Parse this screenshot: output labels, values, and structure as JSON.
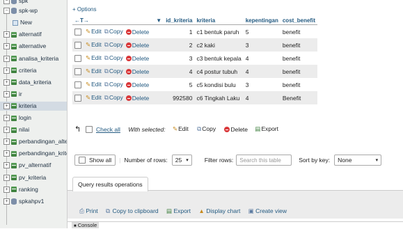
{
  "nav": {
    "top_partial": "spk",
    "items": [
      {
        "label": "spk-wp",
        "kind": "db",
        "expander": "−"
      },
      {
        "label": "New",
        "kind": "new",
        "expander": ""
      },
      {
        "label": "alternatif",
        "kind": "table",
        "expander": "+"
      },
      {
        "label": "alternative",
        "kind": "table",
        "expander": "+"
      },
      {
        "label": "analisa_kriteria",
        "kind": "table",
        "expander": "+"
      },
      {
        "label": "criteria",
        "kind": "table",
        "expander": "+"
      },
      {
        "label": "data_kriteria",
        "kind": "table",
        "expander": "+"
      },
      {
        "label": "ir",
        "kind": "table",
        "expander": "+"
      },
      {
        "label": "kriteria",
        "kind": "table",
        "expander": "+",
        "selected": true
      },
      {
        "label": "login",
        "kind": "table",
        "expander": "+"
      },
      {
        "label": "nilai",
        "kind": "table",
        "expander": "+"
      },
      {
        "label": "perbandingan_alternatif",
        "kind": "table",
        "expander": "+"
      },
      {
        "label": "perbandingan_kriteria",
        "kind": "table",
        "expander": "+"
      },
      {
        "label": "pv_alternatif",
        "kind": "table",
        "expander": "+"
      },
      {
        "label": "pv_kriteria",
        "kind": "table",
        "expander": "+"
      },
      {
        "label": "ranking",
        "kind": "table",
        "expander": "+"
      },
      {
        "label": "spkahpv1",
        "kind": "db",
        "expander": "+"
      }
    ]
  },
  "options_link": "+ Options",
  "table": {
    "header_arrows": "←T→",
    "sort_indicator": "▼",
    "columns": [
      "id_kriteria",
      "kriteria",
      "kepentingan",
      "cost_benefit"
    ],
    "actions": {
      "edit": "Edit",
      "copy": "Copy",
      "delete": "Delete"
    },
    "rows": [
      {
        "id": "1",
        "kriteria": "c1 bentuk paruh",
        "kepentingan": "5",
        "cost_benefit": "benefit"
      },
      {
        "id": "2",
        "kriteria": "c2 kaki",
        "kepentingan": "3",
        "cost_benefit": "benefit"
      },
      {
        "id": "3",
        "kriteria": "c3 bentuk kepala",
        "kepentingan": "4",
        "cost_benefit": "benefit"
      },
      {
        "id": "4",
        "kriteria": "c4 postur tubuh",
        "kepentingan": "4",
        "cost_benefit": "benefit"
      },
      {
        "id": "5",
        "kriteria": "c5 kondisi bulu",
        "kepentingan": "3",
        "cost_benefit": "benefit"
      },
      {
        "id": "992580",
        "kriteria": "c6 Tingkah Laku",
        "kepentingan": "4",
        "cost_benefit": "Benefit"
      }
    ]
  },
  "bulk": {
    "arrow": "↰",
    "check_all": "Check all",
    "with_selected": "With selected:",
    "edit": "Edit",
    "copy": "Copy",
    "delete": "Delete",
    "export": "Export"
  },
  "navigation": {
    "show_all": "Show all",
    "rows_label": "Number of rows:",
    "rows_value": "25",
    "filter_label": "Filter rows:",
    "filter_placeholder": "Search this table",
    "sort_label": "Sort by key:",
    "sort_value": "None"
  },
  "qro": {
    "title": "Query results operations",
    "print": "Print",
    "copy_clipboard": "Copy to clipboard",
    "export": "Export",
    "display_chart": "Display chart",
    "create_view": "Create view"
  },
  "console_label": "Console",
  "colors": {
    "link": "#235a81",
    "delete": "#d9383a",
    "row_alt": "#ececec",
    "nav_bg": "#eef0ee"
  }
}
